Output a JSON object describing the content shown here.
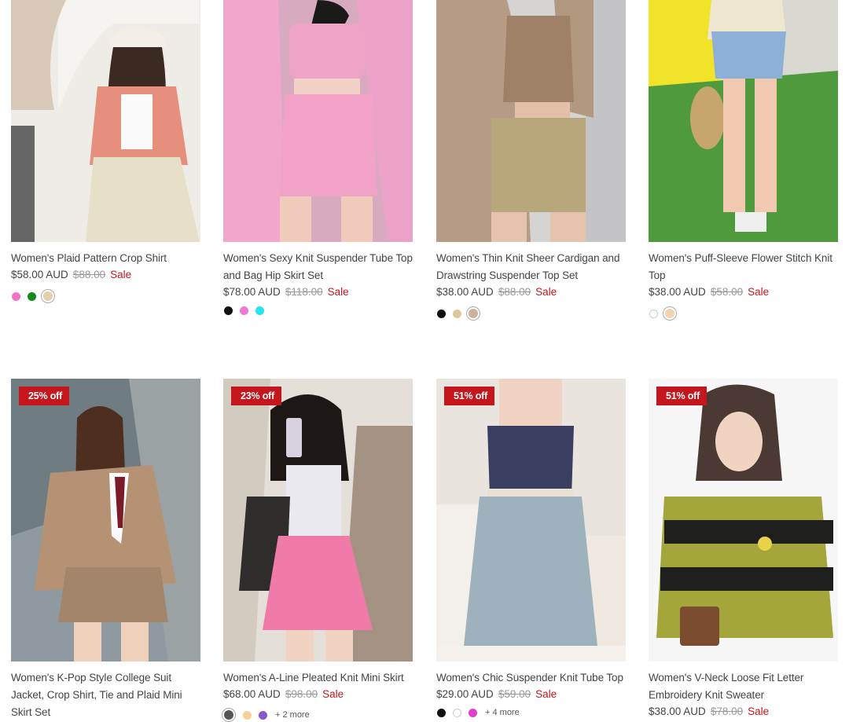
{
  "products": [
    {
      "title": "Women's Plaid Pattern Crop Shirt",
      "price": "$58.00 AUD",
      "compare_price": "$88.00",
      "sale_label": "Sale",
      "badge": "",
      "swatches": [
        "#f073c8",
        "#118a18",
        "#e6cfa8"
      ],
      "selected_swatch": 2
    },
    {
      "title": "Women's Sexy Knit Suspender Tube Top and Bag Hip Skirt Set",
      "price": "$78.00 AUD",
      "compare_price": "$118.00",
      "sale_label": "Sale",
      "badge": "",
      "swatches": [
        "#111111",
        "#ee77d8",
        "#22e6ee"
      ],
      "selected_swatch": -1
    },
    {
      "title": "Women's Thin Knit Sheer Cardigan and Drawstring Suspender Top Set",
      "price": "$38.00 AUD",
      "compare_price": "$88.00",
      "sale_label": "Sale",
      "badge": "",
      "swatches": [
        "#111111",
        "#dcc89a",
        "#c9b39a"
      ],
      "selected_swatch": 2
    },
    {
      "title": "Women's Puff-Sleeve Flower Stitch Knit Top",
      "price": "$38.00 AUD",
      "compare_price": "$58.00",
      "sale_label": "Sale",
      "badge": "",
      "swatches": [
        "#ffffff",
        "#f3d2b0"
      ],
      "selected_swatch": 1
    },
    {
      "title": "Women's K-Pop Style College Suit Jacket, Crop Shirt, Tie and Plaid Mini Skirt Set",
      "price": "",
      "compare_price": "",
      "sale_label": "",
      "badge": "25% off",
      "swatches": [],
      "selected_swatch": -1
    },
    {
      "title": "Women's A-Line Pleated Knit Mini Skirt",
      "price": "$68.00 AUD",
      "compare_price": "$98.00",
      "sale_label": "Sale",
      "badge": "23% off",
      "swatches": [
        "#555555",
        "#f6cf9a",
        "#8a55d0"
      ],
      "selected_swatch": 0,
      "more_label": "+ 2 more"
    },
    {
      "title": "Women's Chic Suspender Knit Tube Top",
      "price": "$29.00 AUD",
      "compare_price": "$59.00",
      "sale_label": "Sale",
      "badge": "51% off",
      "swatches": [
        "#111111",
        "#ffffff",
        "#e040c8"
      ],
      "selected_swatch": -1,
      "more_label": "+ 4 more"
    },
    {
      "title": "Women's V-Neck Loose Fit Letter Embroidery Knit Sweater",
      "price": "$38.00 AUD",
      "compare_price": "$78.00",
      "sale_label": "Sale",
      "badge": "51% off",
      "swatches": [],
      "selected_swatch": -1
    }
  ]
}
